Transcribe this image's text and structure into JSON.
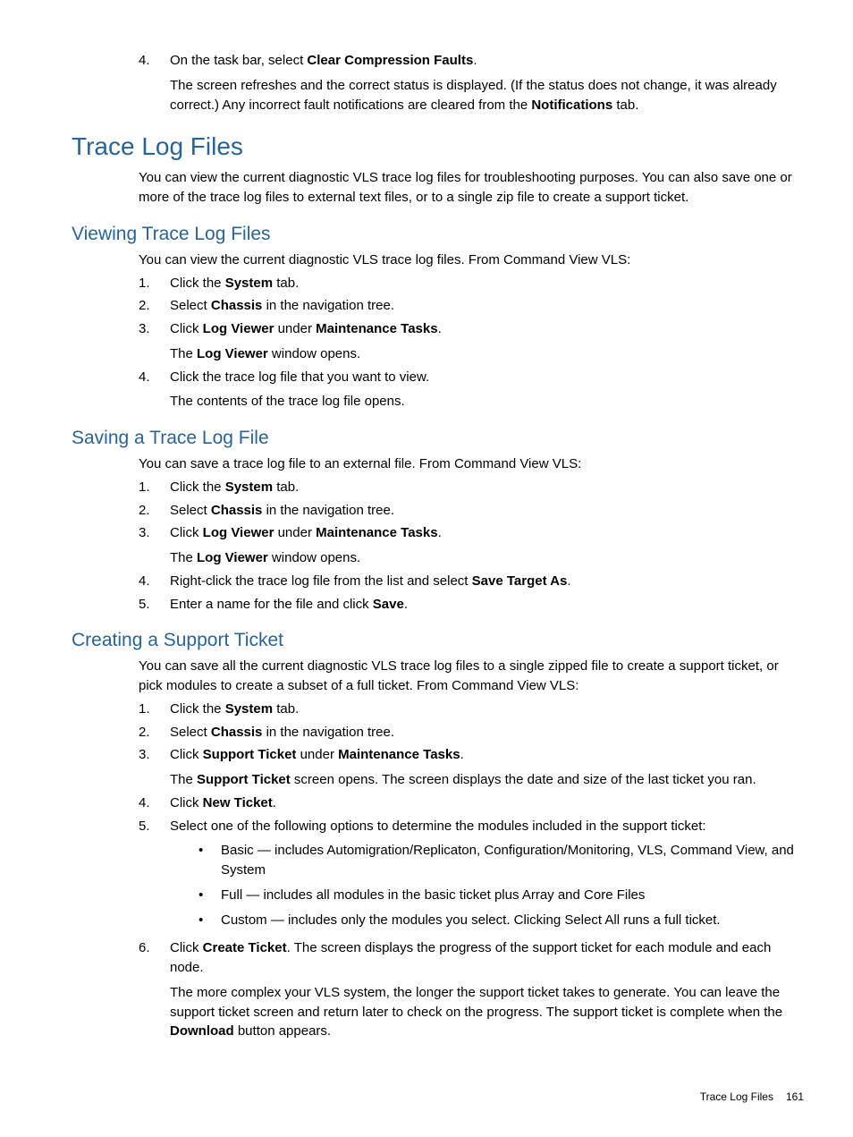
{
  "top_step": {
    "num": "4.",
    "line1_a": "On the task bar, select ",
    "line1_b": "Clear Compression Faults",
    "line1_c": ".",
    "sub_a": "The screen refreshes and the correct status is displayed. (If the status does not change, it was already correct.) Any incorrect fault notifications are cleared from the ",
    "sub_b": "Notifications",
    "sub_c": " tab."
  },
  "h1": "Trace Log Files",
  "intro": "You can view the current diagnostic VLS trace log files for troubleshooting purposes. You can also save one or more of the trace log files to external text files, or to a single zip file to create a support ticket.",
  "view": {
    "heading": "Viewing Trace Log Files",
    "intro": "You can view the current diagnostic VLS trace log files. From Command View VLS:",
    "s1": {
      "num": "1.",
      "a": "Click the ",
      "b": "System",
      "c": " tab."
    },
    "s2": {
      "num": "2.",
      "a": "Select ",
      "b": "Chassis",
      "c": " in the navigation tree."
    },
    "s3": {
      "num": "3.",
      "a": "Click ",
      "b": "Log Viewer",
      "c": " under ",
      "d": "Maintenance Tasks",
      "e": ".",
      "sub_a": "The ",
      "sub_b": "Log Viewer",
      "sub_c": " window opens."
    },
    "s4": {
      "num": "4.",
      "a": "Click the trace log file that you want to view.",
      "sub": "The contents of the trace log file opens."
    }
  },
  "save": {
    "heading": "Saving a Trace Log File",
    "intro": "You can save a trace log file to an external file. From Command View VLS:",
    "s1": {
      "num": "1.",
      "a": "Click the ",
      "b": "System",
      "c": " tab."
    },
    "s2": {
      "num": "2.",
      "a": "Select ",
      "b": "Chassis",
      "c": " in the navigation tree."
    },
    "s3": {
      "num": "3.",
      "a": "Click ",
      "b": "Log Viewer",
      "c": " under ",
      "d": "Maintenance Tasks",
      "e": ".",
      "sub_a": "The ",
      "sub_b": "Log Viewer",
      "sub_c": " window opens."
    },
    "s4": {
      "num": "4.",
      "a": "Right-click the trace log file from the list and select ",
      "b": "Save Target As",
      "c": "."
    },
    "s5": {
      "num": "5.",
      "a": "Enter a name for the file and click ",
      "b": "Save",
      "c": "."
    }
  },
  "ticket": {
    "heading": "Creating a Support Ticket",
    "intro": "You can save all the current diagnostic VLS trace log files to a single zipped file to create a support ticket, or pick modules to create a subset of a full ticket. From Command View VLS:",
    "s1": {
      "num": "1.",
      "a": "Click the ",
      "b": "System",
      "c": " tab."
    },
    "s2": {
      "num": "2.",
      "a": "Select ",
      "b": "Chassis",
      "c": " in the navigation tree."
    },
    "s3": {
      "num": "3.",
      "a": "Click ",
      "b": "Support Ticket",
      "c": " under ",
      "d": "Maintenance Tasks",
      "e": ".",
      "sub_a": "The ",
      "sub_b": "Support Ticket",
      "sub_c": " screen opens. The screen displays the date and size of the last ticket you ran."
    },
    "s4": {
      "num": "4.",
      "a": "Click ",
      "b": "New Ticket",
      "c": "."
    },
    "s5": {
      "num": "5.",
      "a": "Select one of the following options to determine the modules included in the support ticket:"
    },
    "b1": "Basic — includes Automigration/Replicaton, Configuration/Monitoring, VLS, Command View, and System",
    "b2": "Full — includes all modules in the basic ticket plus Array and Core Files",
    "b3": "Custom — includes only the modules you select. Clicking Select All runs a full ticket.",
    "s6": {
      "num": "6.",
      "a": "Click ",
      "b": "Create Ticket",
      "c": ". The screen displays the progress of the support ticket for each module and each node.",
      "sub_a": "The more complex your VLS system, the longer the support ticket takes to generate. You can leave the support ticket screen and return later to check on the progress. The support ticket is complete when the ",
      "sub_b": "Download",
      "sub_c": " button appears."
    }
  },
  "footer": {
    "section": "Trace Log Files",
    "page": "161"
  }
}
